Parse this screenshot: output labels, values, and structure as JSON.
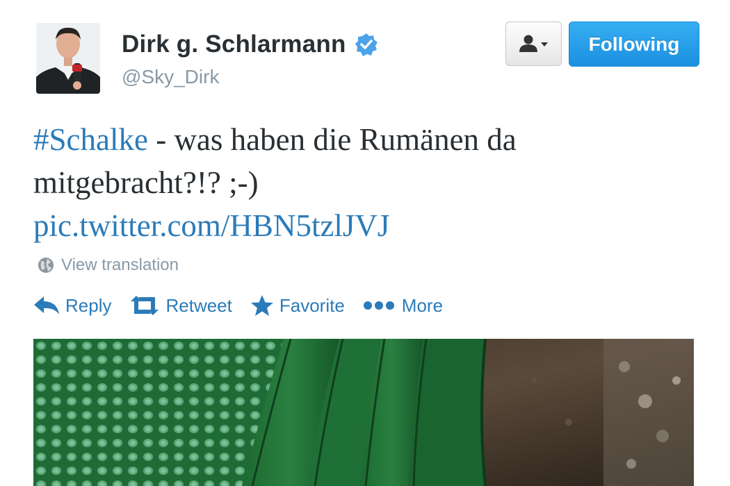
{
  "profile": {
    "display_name": "Dirk g. Schlarmann",
    "handle": "@Sky_Dirk",
    "verified_icon": "verified-badge-icon",
    "avatar": "profile-photo"
  },
  "buttons": {
    "user_actions_icon": "user-dropdown-icon",
    "follow_label": "Following"
  },
  "tweet": {
    "hashtag": "#Schalke",
    "text": " - was haben die Rumänen da mitgebracht?!? ;-) ",
    "link": "pic.twitter.com/HBN5tzlJVJ"
  },
  "translation": {
    "icon": "globe-icon",
    "label": "View translation"
  },
  "actions": [
    {
      "icon": "reply-icon",
      "label": "Reply"
    },
    {
      "icon": "retweet-icon",
      "label": "Retweet"
    },
    {
      "icon": "star-icon",
      "label": "Favorite"
    },
    {
      "icon": "more-dots-icon",
      "label": "More"
    }
  ],
  "colors": {
    "link_blue": "#2b7bb9",
    "verified_blue": "#4da3e8",
    "follow_button": "#2295e3",
    "muted_text": "#8899a6",
    "text": "#292f33"
  }
}
